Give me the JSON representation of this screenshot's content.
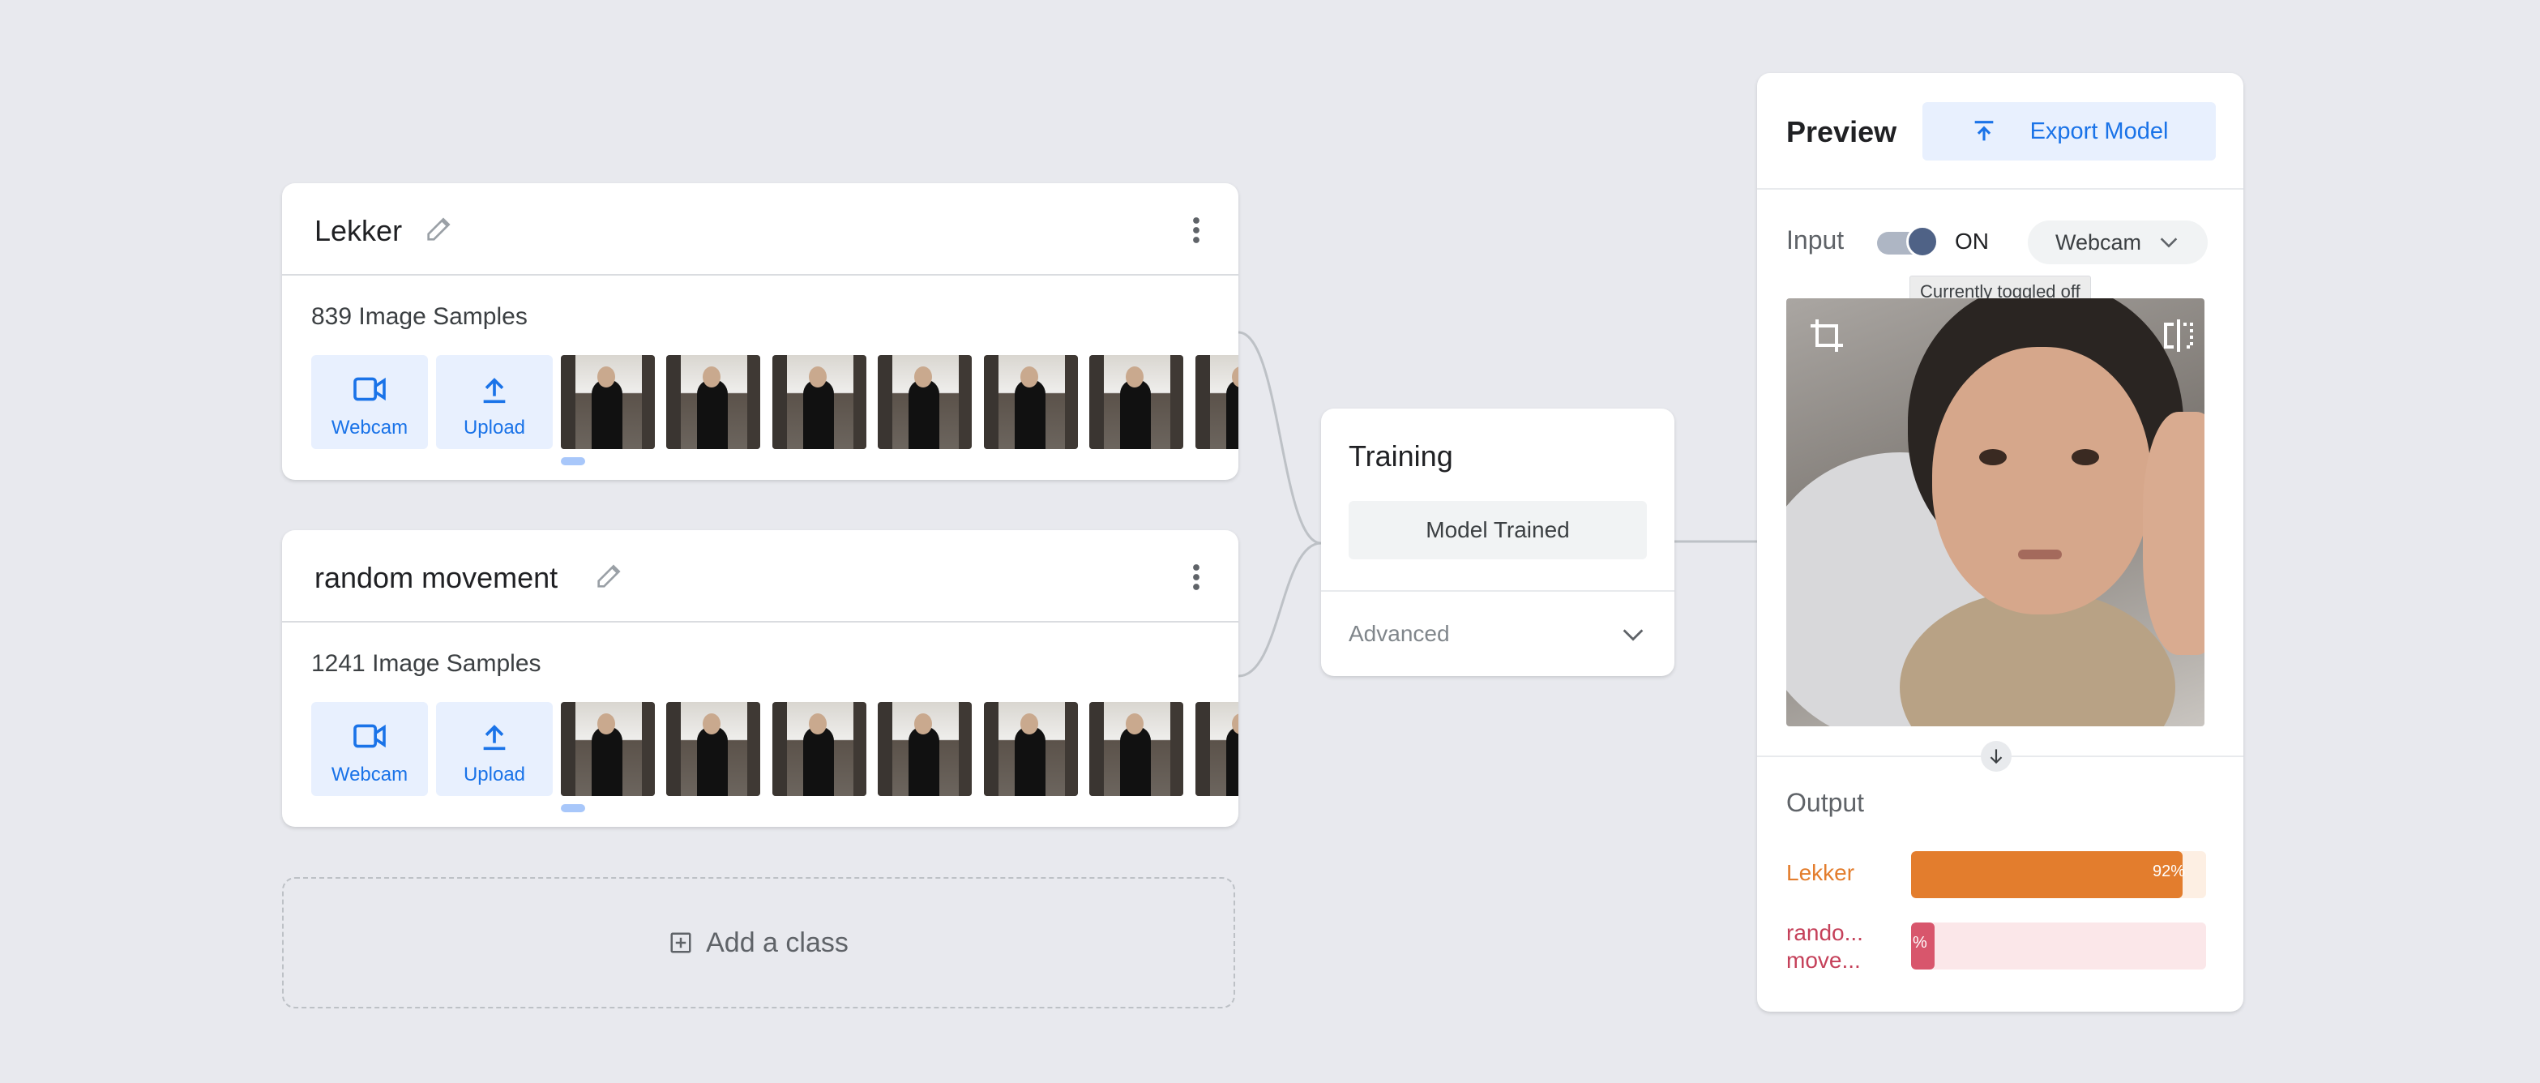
{
  "classes": [
    {
      "title": "Lekker",
      "samples": "839 Image Samples",
      "webcam_label": "Webcam",
      "upload_label": "Upload"
    },
    {
      "title": "random movement",
      "samples": "1241 Image Samples",
      "webcam_label": "Webcam",
      "upload_label": "Upload"
    }
  ],
  "add_class": {
    "label": "Add a class"
  },
  "training": {
    "title": "Training",
    "button": "Model Trained",
    "advanced": "Advanced"
  },
  "preview": {
    "title": "Preview",
    "export_label": "Export Model",
    "input_label": "Input",
    "toggle_state": "ON",
    "source_select": "Webcam",
    "tooltip": "Currently toggled off",
    "output_label": "Output",
    "outputs": [
      {
        "name": "Lekker",
        "value": 0.92,
        "pct_label": "92%",
        "color": "#e37d2d",
        "track": "#fdefe3",
        "text_color": "#e37d2d"
      },
      {
        "name": "rando... move...",
        "value": 0.05,
        "pct_label": "%",
        "color": "#d8566c",
        "track": "#fbe7e9",
        "text_color": "#c5415a"
      }
    ]
  },
  "colors": {
    "accent": "#1a73e8",
    "button_bg": "#e8f0fe",
    "background": "#e8e9ee"
  }
}
